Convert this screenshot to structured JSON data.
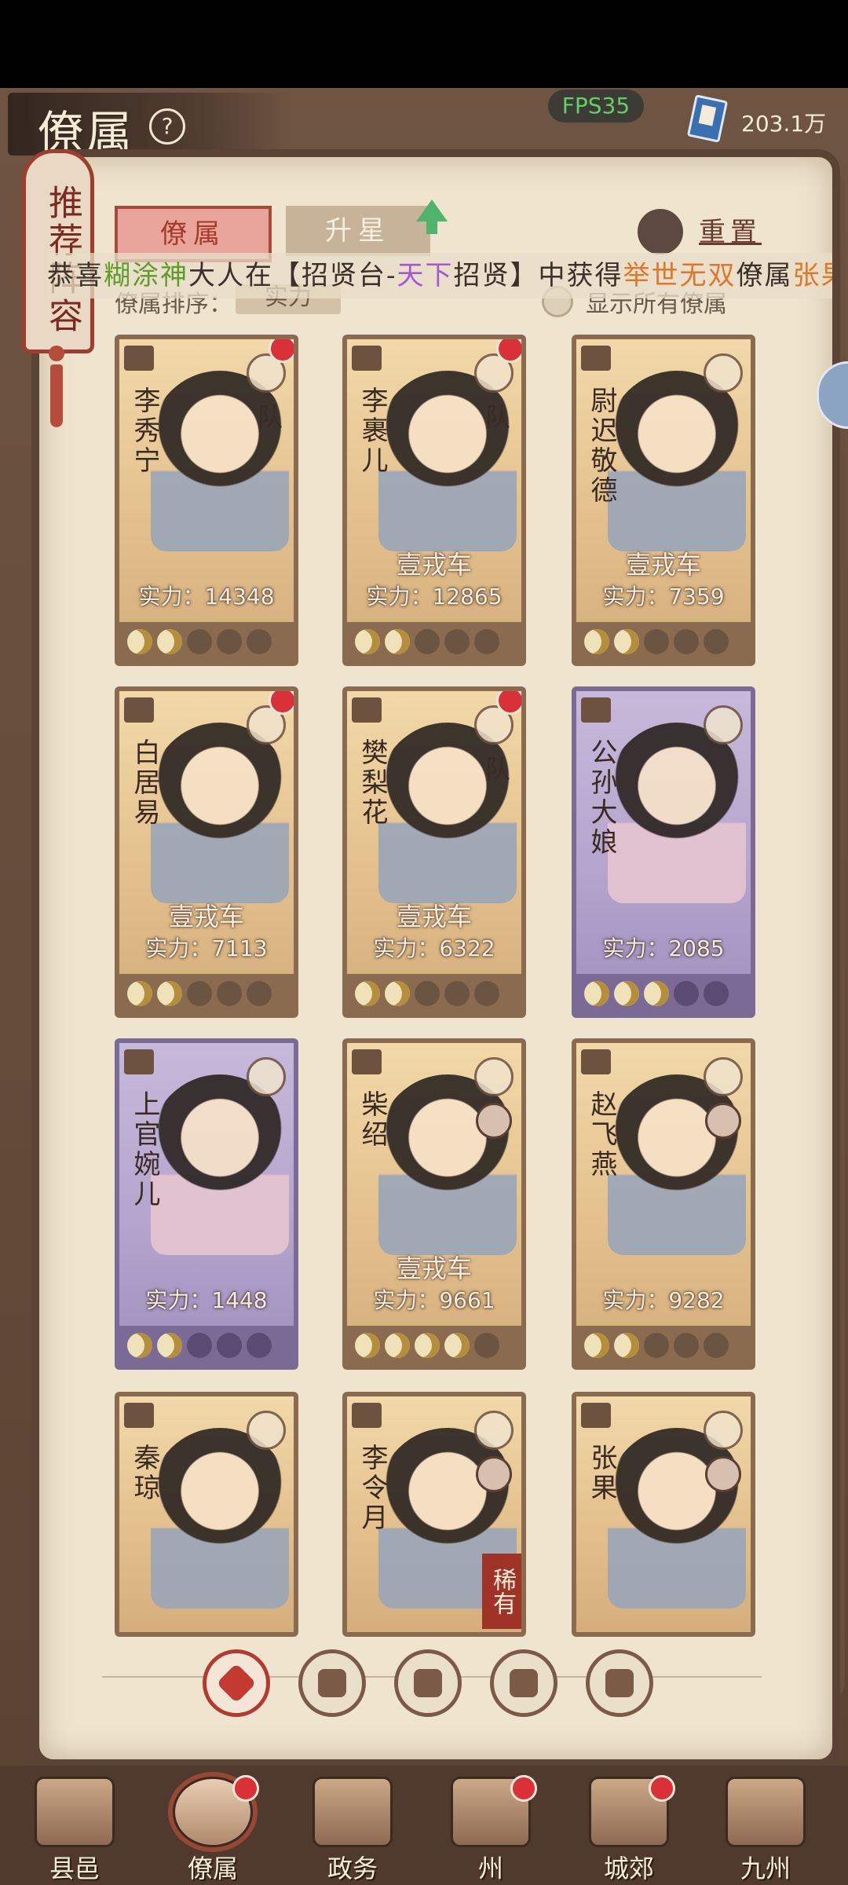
{
  "header": {
    "title": "僚属",
    "fps": "FPS35",
    "currency": "203.1万"
  },
  "recommend": "推荐阵容",
  "tabs": {
    "active": "僚属",
    "inactive": "升星",
    "reset": "重置"
  },
  "marquee": {
    "p1": "恭喜",
    "name": "糊涂神",
    "p2": "大人在【招贤台-",
    "place": "天下",
    "p3": "招贤】中获得",
    "quality": "举世无双",
    "p4": "僚属",
    "target": "张果"
  },
  "sort": {
    "label": "僚属排序：",
    "value": "实力"
  },
  "show_all": "显示所有僚属",
  "cards": [
    {
      "name": "李秀宁",
      "prestige": "",
      "power": "实力：14348",
      "team": "队",
      "moons": [
        1,
        1,
        0,
        0,
        0
      ]
    },
    {
      "name": "李裹儿",
      "prestige": "壹戎车",
      "power": "实力：12865",
      "team": "队",
      "moons": [
        1,
        1,
        0,
        0,
        0
      ]
    },
    {
      "name": "尉迟敬德",
      "prestige": "壹戎车",
      "power": "实力：7359",
      "team": "",
      "moons": [
        1,
        1,
        0,
        0,
        0
      ]
    },
    {
      "name": "白居易",
      "prestige": "壹戎车",
      "power": "实力：7113",
      "team": "",
      "moons": [
        1,
        1,
        0,
        0,
        0
      ]
    },
    {
      "name": "樊梨花",
      "prestige": "壹戎车",
      "power": "实力：6322",
      "team": "队",
      "moons": [
        1,
        1,
        0,
        0,
        0
      ]
    },
    {
      "name": "公孙大娘",
      "prestige": "",
      "power": "实力：2085",
      "team": "",
      "moons": [
        1,
        1,
        1,
        0,
        0
      ]
    },
    {
      "name": "上官婉儿",
      "prestige": "",
      "power": "实力：1448",
      "team": "",
      "moons": [
        1,
        1,
        0,
        0,
        0
      ]
    },
    {
      "name": "柴绍",
      "prestige": "壹戎车",
      "power": "实力：9661",
      "team": "",
      "moons": [
        1,
        1,
        1,
        1,
        0
      ]
    },
    {
      "name": "赵飞燕",
      "prestige": "",
      "power": "实力：9282",
      "team": "",
      "moons": [
        1,
        1,
        0,
        0,
        0
      ]
    },
    {
      "name": "秦琼",
      "prestige": "",
      "power": "",
      "team": "",
      "moons": []
    },
    {
      "name": "李令月",
      "prestige": "",
      "power": "",
      "team": "",
      "rarity": "稀有",
      "moons": []
    },
    {
      "name": "张果",
      "prestige": "",
      "power": "",
      "team": "",
      "moons": []
    }
  ],
  "filters": [
    "all-filter-icon",
    "helmet-filter-icon",
    "gourd-filter-icon",
    "fan-filter-icon",
    "lion-filter-icon"
  ],
  "nav": [
    {
      "label": "县邑"
    },
    {
      "label": "僚属"
    },
    {
      "label": "政务"
    },
    {
      "label": "州"
    },
    {
      "label": "城郊"
    },
    {
      "label": "九州"
    }
  ]
}
